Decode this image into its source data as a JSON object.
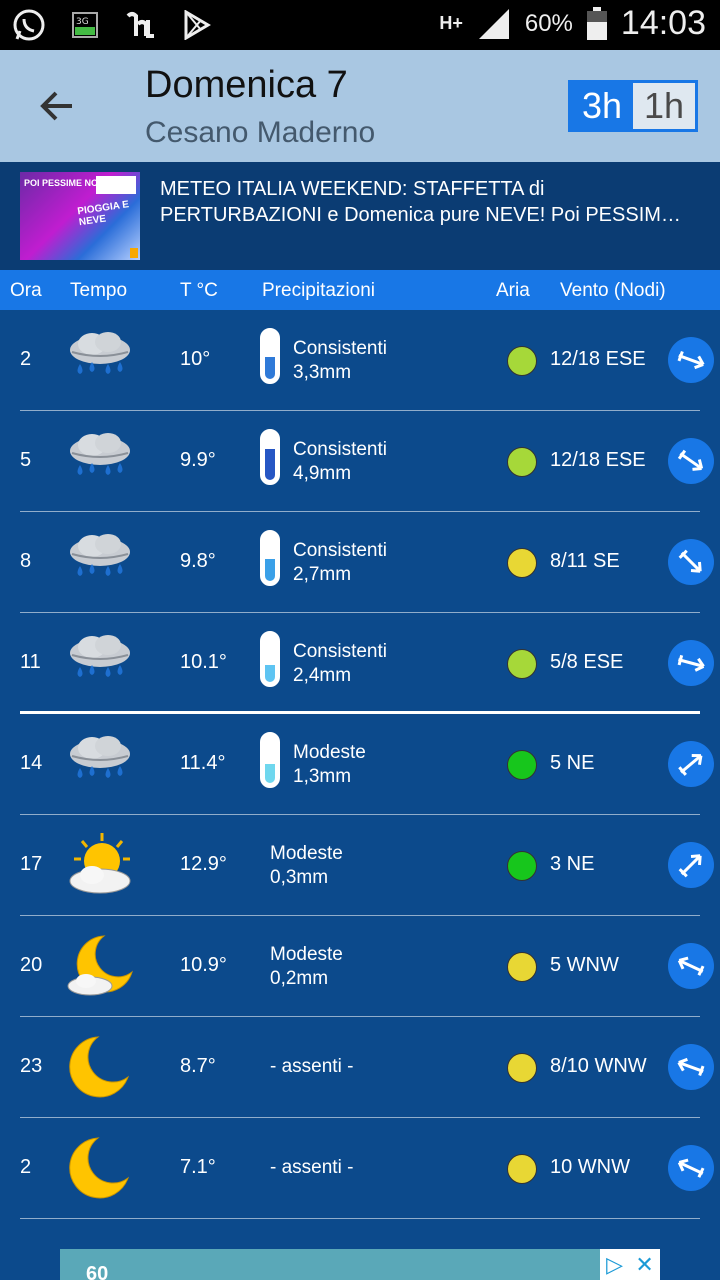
{
  "status_bar": {
    "icons": [
      "whatsapp-icon",
      "3g-icon",
      "app-icon",
      "play-store-icon"
    ],
    "network": "H+",
    "battery": "60%",
    "time": "14:03"
  },
  "header": {
    "title": "Domenica 7",
    "subtitle": "Cesano Maderno",
    "toggle": {
      "active": "3h",
      "inactive": "1h"
    }
  },
  "news": {
    "headline": "METEO ITALIA WEEKEND: STAFFETTA di PERTURBAZIONI e Domenica pure NEVE! Poi PESSIM…",
    "thumb_text_1": "POI PESSIME NOTIZIE",
    "thumb_text_2": "PIOGGIA E NEVE"
  },
  "table_headers": {
    "ora": "Ora",
    "tempo": "Tempo",
    "temp": "T °C",
    "precip": "Precipitazioni",
    "aria": "Aria",
    "vento": "Vento (Nodi)"
  },
  "rows": [
    {
      "hour": "2",
      "icon": "rain-cloud-icon",
      "temp": "10°",
      "gauge": 0.45,
      "gauge_color": "#2f7ad8",
      "precip": [
        "Consistenti",
        "3,3mm"
      ],
      "aria": "#a6d839",
      "vento": "12/18 ESE",
      "wind_icon": "wind-arrow-ese-icon",
      "wind_deg": 200
    },
    {
      "hour": "5",
      "icon": "rain-cloud-icon",
      "temp": "9.9°",
      "gauge": 0.65,
      "gauge_color": "#2656c4",
      "precip": [
        "Consistenti",
        "4,9mm"
      ],
      "aria": "#a6d839",
      "vento": "12/18 ESE",
      "wind_icon": "wind-arrow-ese-icon",
      "wind_deg": 215
    },
    {
      "hour": "8",
      "icon": "rain-cloud-icon",
      "temp": "9.8°",
      "gauge": 0.45,
      "gauge_color": "#3aa0e8",
      "precip": [
        "Consistenti",
        "2,7mm"
      ],
      "aria": "#e8d734",
      "vento": "8/11 SE",
      "wind_icon": "wind-arrow-se-icon",
      "wind_deg": 225
    },
    {
      "hour": "11",
      "icon": "rain-cloud-icon",
      "temp": "10.1°",
      "gauge": 0.35,
      "gauge_color": "#5ec4f2",
      "precip": [
        "Consistenti",
        "2,4mm"
      ],
      "aria": "#a6d839",
      "vento": "5/8 ESE",
      "wind_icon": "wind-arrow-ese-icon",
      "wind_deg": 195
    },
    {
      "hour": "14",
      "icon": "rain-cloud-icon",
      "temp": "11.4°",
      "gauge": 0.4,
      "gauge_color": "#6fd7ee",
      "precip": [
        "Modeste",
        "1,3mm"
      ],
      "aria": "#17c61c",
      "vento": "5 NE",
      "wind_icon": "wind-arrow-ne-icon",
      "wind_deg": 140
    },
    {
      "hour": "17",
      "icon": "sun-cloud-icon",
      "temp": "12.9°",
      "gauge": null,
      "precip": [
        "Modeste",
        "0,3mm"
      ],
      "aria": "#17c61c",
      "vento": "3 NE",
      "wind_icon": "wind-arrow-ne-icon",
      "wind_deg": 135
    },
    {
      "hour": "20",
      "icon": "moon-cloud-icon",
      "temp": "10.9°",
      "gauge": null,
      "precip": [
        "Modeste",
        "0,2mm"
      ],
      "aria": "#e8d734",
      "vento": "5 WNW",
      "wind_icon": "wind-arrow-wnw-icon",
      "wind_deg": 25
    },
    {
      "hour": "23",
      "icon": "moon-icon",
      "temp": "8.7°",
      "gauge": null,
      "precip": [
        "- assenti -"
      ],
      "aria": "#e8d734",
      "vento": "8/10 WNW",
      "wind_icon": "wind-arrow-wnw-icon",
      "wind_deg": 20
    },
    {
      "hour": "2",
      "icon": "moon-icon",
      "temp": "7.1°",
      "gauge": null,
      "precip": [
        "- assenti -"
      ],
      "aria": "#e8d734",
      "vento": "10 WNW",
      "wind_icon": "wind-arrow-wnw-icon",
      "wind_deg": 25
    }
  ],
  "ad": {
    "text": "60"
  }
}
